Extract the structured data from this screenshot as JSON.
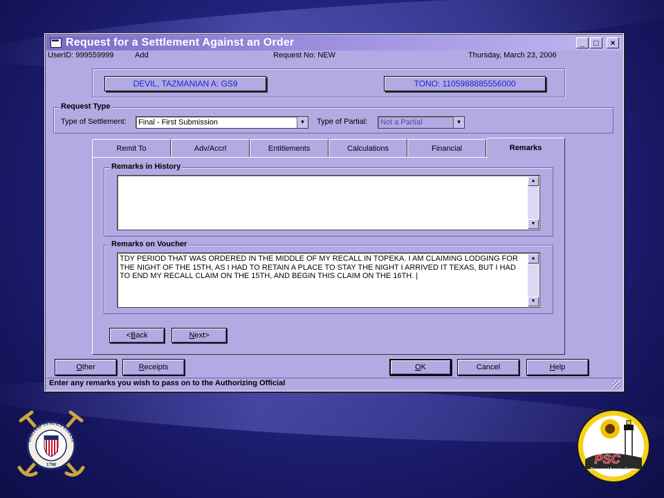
{
  "window": {
    "title": "Request for a Settlement Against an Order",
    "minimize": "_",
    "maximize": "□",
    "close": "×"
  },
  "infobar": {
    "user": "UserID: 999559999",
    "mode": "Add",
    "request": "Request No:  NEW",
    "date": "Thursday, March 23, 2006"
  },
  "member": {
    "name": "DEVIL, TAZMANIAN A: GS9",
    "tono": "TONO: 1105988885556000"
  },
  "request_type": {
    "legend": "Request Type",
    "settlement_label": "Type of Settlement:",
    "settlement_value": "Final - First Submission",
    "partial_label": "Type of Partial:",
    "partial_value": "Not a Partial"
  },
  "tabs": [
    {
      "label": "Remit To"
    },
    {
      "label": "Adv/Accrl"
    },
    {
      "label": "Entitlements"
    },
    {
      "label": "Calculations"
    },
    {
      "label": "Financial"
    },
    {
      "label": "Remarks"
    }
  ],
  "remarks": {
    "history_legend": "Remarks in History",
    "history_text": "",
    "voucher_legend": "Remarks on Voucher",
    "voucher_text": "TDY PERIOD THAT WAS ORDERED IN THE MIDDLE OF MY RECALL IN TOPEKA.  I AM CLAIMING LODGING FOR THE NIGHT OF THE 15TH, AS I HAD TO RETAIN A PLACE TO STAY THE NIGHT I ARRIVED IT TEXAS, BUT I HAD TO END MY RECALL CLAIM ON THE 15TH, AND BEGIN THIS CLAIM ON THE 16TH. |"
  },
  "nav": {
    "back_prefix": "<",
    "back_key": "B",
    "back_rest": "ack",
    "next_key": "N",
    "next_rest": "ext>"
  },
  "footer_buttons": {
    "other_key": "O",
    "other_rest": "ther",
    "receipts_key": "R",
    "receipts_rest": "eceipts",
    "ok_key": "O",
    "ok_rest": "K",
    "cancel": "Cancel",
    "help_key": "H",
    "help_rest": "elp"
  },
  "status": "Enter any remarks you wish to pass on to the Authorizing Official",
  "logos": {
    "coast_guard_top": "UNITED STATES COAST GUARD",
    "coast_guard_year": "1790",
    "psc_main": "PSC",
    "psc_sub": "Personnel Service Center",
    "psc_city": "TOPEKA"
  },
  "colors": {
    "window_bg": "#b3a9e3",
    "title_gradient_start": "#7c6bc8",
    "link_blue": "#1a24c8",
    "background": "#23237e"
  }
}
